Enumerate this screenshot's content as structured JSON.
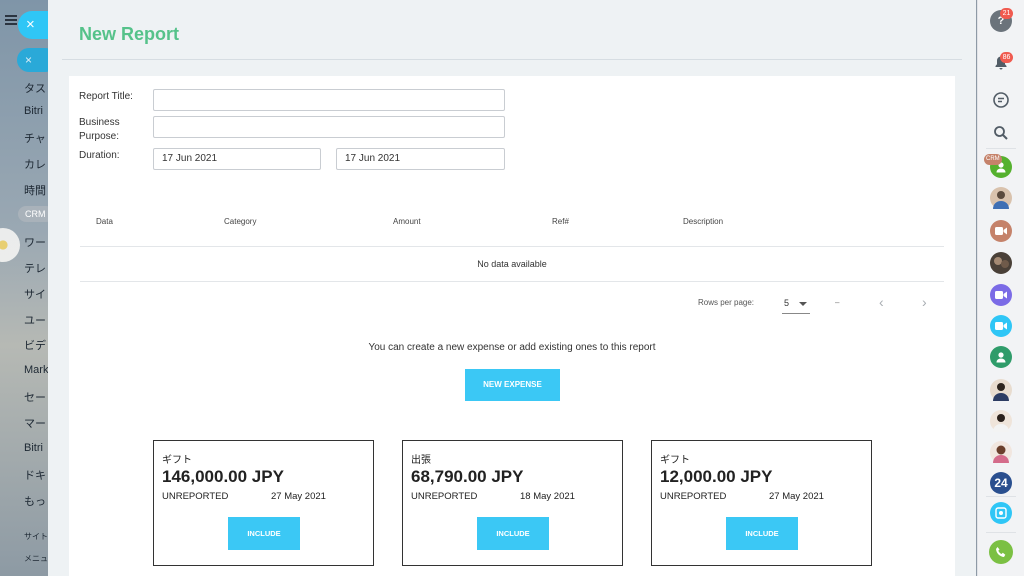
{
  "left_sidebar": {
    "items": [
      "タス",
      "Bitri",
      "チャ",
      "カレ",
      "時間",
      "ワー",
      "テレ",
      "サイ",
      "ユー",
      "ビデ",
      "Mark",
      "セー",
      "マー",
      "Bitri",
      "ドキ",
      "もっ"
    ],
    "crm_badge": "CRM",
    "small_items": [
      "サイト",
      "メニュ"
    ],
    "close_icon": "×",
    "pill_icon": "×"
  },
  "header": {
    "title": "New Report"
  },
  "form": {
    "report_title_label": "Report Title:",
    "report_title_value": "",
    "business_purpose_label": "Business Purpose:",
    "business_purpose_value": "",
    "duration_label": "Duration:",
    "duration_start": "17 Jun 2021",
    "duration_end": "17 Jun 2021"
  },
  "table": {
    "columns": [
      "Data",
      "Category",
      "Amount",
      "Ref#",
      "Description"
    ],
    "empty_text": "No data available",
    "rows_per_page_label": "Rows per page:",
    "rows_per_page_value": "5",
    "range_text": "–",
    "prev_icon": "‹",
    "next_icon": "›"
  },
  "hint": "You can create a new expense or add existing ones to this report",
  "new_expense_label": "NEW EXPENSE",
  "expenses": [
    {
      "category": "ギフト",
      "amount": "146,000.00 JPY",
      "status": "UNREPORTED",
      "date": "27 May 2021",
      "action": "INCLUDE"
    },
    {
      "category": "出張",
      "amount": "68,790.00 JPY",
      "status": "UNREPORTED",
      "date": "18 May 2021",
      "action": "INCLUDE"
    },
    {
      "category": "ギフト",
      "amount": "12,000.00 JPY",
      "status": "UNREPORTED",
      "date": "27 May 2021",
      "action": "INCLUDE"
    }
  ],
  "right_sidebar": {
    "help_badge": "21",
    "notifications_badge": "86",
    "crm_tag": "CRM",
    "counter_avatar": "24",
    "colors": {
      "green": "#55b12e",
      "purple": "#7b6be6",
      "cyan": "#2fc6f6",
      "orange": "#c5826a",
      "call": "#7bc043"
    }
  }
}
